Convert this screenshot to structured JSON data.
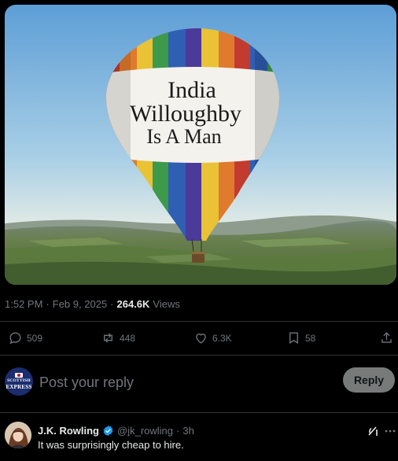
{
  "post": {
    "image_text": [
      "India",
      "Willoughby",
      "Is A Man"
    ],
    "time": "1:52 PM",
    "date": "Feb 9, 2025",
    "views_count": "264.6K",
    "views_label": "Views"
  },
  "actions": {
    "replies": "509",
    "reposts": "448",
    "likes": "6.3K",
    "bookmarks": "58"
  },
  "reply_box": {
    "avatar_text_top": "SCOTTISH",
    "avatar_text_bottom": "EXPRESS",
    "placeholder": "Post your reply",
    "button_label": "Reply"
  },
  "comment": {
    "name": "J.K. Rowling",
    "handle": "@jk_rowling",
    "separator": "·",
    "time": "3h",
    "text": "It was surprisingly cheap to hire."
  },
  "colors": {
    "verified": "#1d9bf0",
    "muted": "#71767b",
    "background": "#000000"
  }
}
